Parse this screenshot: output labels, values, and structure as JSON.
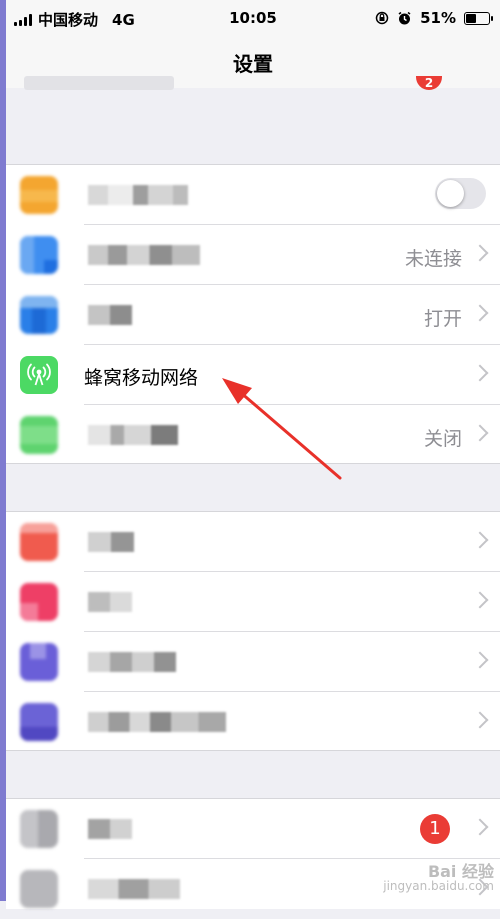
{
  "status_bar": {
    "carrier": "中国移动",
    "network": "4G",
    "time": "10:05",
    "battery": "51%",
    "battery_level": 0.51
  },
  "navbar": {
    "title": "设置",
    "top_badge": "2"
  },
  "rows": {
    "wifi_value": "未连接",
    "bluetooth_value": "打开",
    "cellular_label": "蜂窝移动网络",
    "hotspot_value": "关闭",
    "general_badge": "1"
  },
  "watermark": {
    "line1": "Bai 经验",
    "line2": "jingyan.baidu.com"
  },
  "colors": {
    "cellular_icon": "#4cd964",
    "annotation_arrow": "#e8312a",
    "badge": "#ea3c35"
  }
}
